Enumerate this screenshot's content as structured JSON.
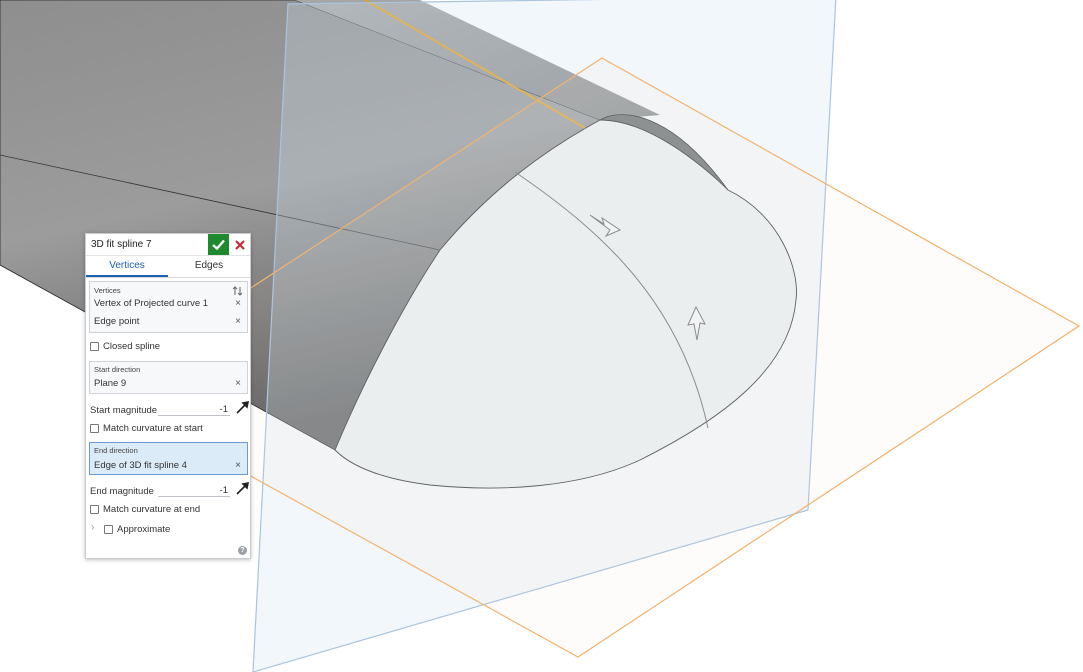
{
  "dialog": {
    "title": "3D fit spline 7",
    "ok_icon": "checkmark-icon",
    "cancel_icon": "close-icon",
    "tabs": [
      "Vertices",
      "Edges"
    ],
    "active_tab": "Vertices",
    "vertices_label": "Vertices",
    "vertices": [
      "Vertex of Projected curve 1",
      "Edge point"
    ],
    "closed_spline_label": "Closed spline",
    "closed_spline_checked": false,
    "start_direction_label": "Start direction",
    "start_direction_value": "Plane 9",
    "start_magnitude_label": "Start magnitude",
    "start_magnitude_value": "-1",
    "match_curvature_start_label": "Match curvature at start",
    "end_direction_label": "End direction",
    "end_direction_value": "Edge of 3D fit spline 4",
    "end_magnitude_label": "End magnitude",
    "end_magnitude_value": "-1",
    "match_curvature_end_label": "Match curvature at end",
    "approximate_label": "Approximate",
    "help_glyph": "?",
    "remove_glyph": "×"
  },
  "colors": {
    "ok_green": "#1e8a2e",
    "cancel_red": "#c0272d",
    "tab_active_blue": "#1d5fb6",
    "highlight_blue": "#dcebf8",
    "plane_blue": "#a9c4e0",
    "plane_orange": "#f4b26b",
    "edge_orange": "#e8a020"
  }
}
